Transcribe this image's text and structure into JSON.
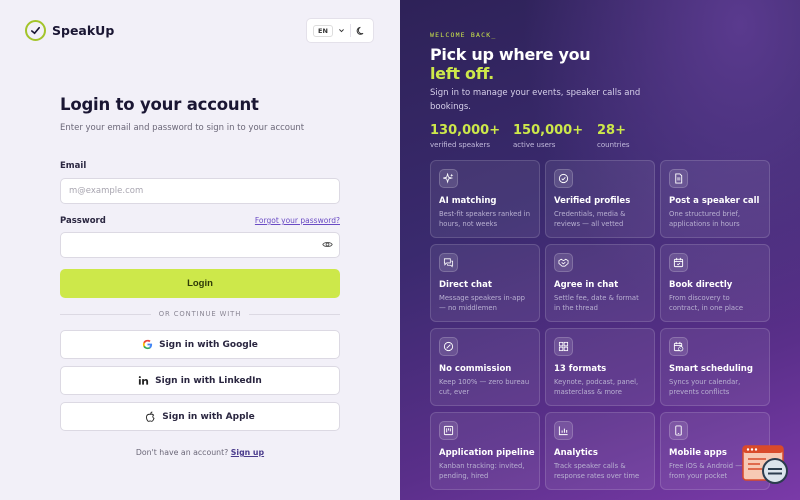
{
  "brand": {
    "name": "SpeakUp",
    "accent": "#cde84a"
  },
  "header": {
    "language": "EN"
  },
  "login": {
    "title": "Login to your account",
    "subtitle": "Enter your email and password to sign in to your account",
    "email_label": "Email",
    "email_placeholder": "m@example.com",
    "email_value": "",
    "password_label": "Password",
    "forgot_label": "Forgot your password?",
    "password_value": "",
    "login_label": "Login",
    "divider_label": "OR CONTINUE WITH",
    "google_label": "Sign in with Google",
    "linkedin_label": "Sign in with LinkedIn",
    "apple_label": "Sign in with Apple",
    "signup_prompt": "Don't have an account?",
    "signup_link": "Sign up"
  },
  "hero": {
    "eyebrow": "WELCOME BACK_",
    "headline_line1": "Pick up where you",
    "headline_accent": "left off.",
    "description": "Sign in to manage your events, speaker calls and bookings.",
    "stats": [
      {
        "value": "130,000+",
        "label": "verified speakers"
      },
      {
        "value": "150,000+",
        "label": "active users"
      },
      {
        "value": "28+",
        "label": "countries"
      }
    ],
    "features": [
      {
        "icon": "sparkles-icon",
        "title": "AI matching",
        "desc": "Best-fit speakers ranked in hours, not weeks"
      },
      {
        "icon": "check-circle-icon",
        "title": "Verified profiles",
        "desc": "Credentials, media & reviews — all vetted"
      },
      {
        "icon": "document-icon",
        "title": "Post a speaker call",
        "desc": "One structured brief, applications in hours"
      },
      {
        "icon": "chat-icon",
        "title": "Direct chat",
        "desc": "Message speakers in-app — no middlemen"
      },
      {
        "icon": "handshake-icon",
        "title": "Agree in chat",
        "desc": "Settle fee, date & format in the thread"
      },
      {
        "icon": "calendar-icon",
        "title": "Book directly",
        "desc": "From discovery to contract, in one place"
      },
      {
        "icon": "percent-icon",
        "title": "No commission",
        "desc": "Keep 100% — zero bureau cut, ever"
      },
      {
        "icon": "grid-icon",
        "title": "13 formats",
        "desc": "Keynote, podcast, panel, masterclass & more"
      },
      {
        "icon": "calendar-clock-icon",
        "title": "Smart scheduling",
        "desc": "Syncs your calendar, prevents conflicts"
      },
      {
        "icon": "kanban-icon",
        "title": "Application pipeline",
        "desc": "Kanban tracking: invited, pending, hired"
      },
      {
        "icon": "bar-chart-icon",
        "title": "Analytics",
        "desc": "Track speaker calls & response rates over time"
      },
      {
        "icon": "phone-icon",
        "title": "Mobile apps",
        "desc": "Free iOS & Android — book from your pocket"
      }
    ]
  }
}
